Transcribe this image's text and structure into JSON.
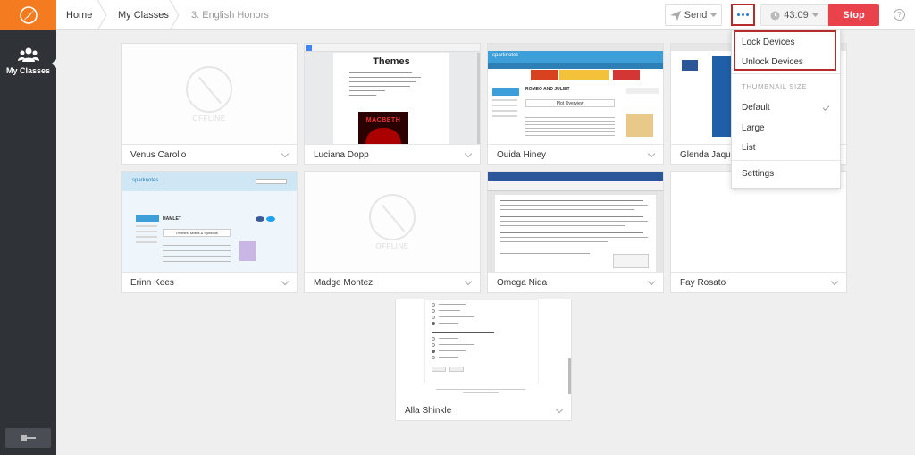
{
  "sidebar": {
    "nav_label": "My Classes"
  },
  "breadcrumb": {
    "items": [
      "Home",
      "My Classes",
      "3. English Honors"
    ]
  },
  "toolbar": {
    "send_label": "Send",
    "timer": "43:09",
    "stop_label": "Stop",
    "help": "?"
  },
  "menu": {
    "lock": "Lock Devices",
    "unlock": "Unlock Devices",
    "thumb_header": "THUMBNAIL SIZE",
    "sizes": [
      "Default",
      "Large",
      "List"
    ],
    "selected": "Default",
    "settings": "Settings"
  },
  "offline_text": "OFFLINE",
  "students": [
    {
      "name": "Venus Carollo",
      "status": "offline"
    },
    {
      "name": "Luciana Dopp",
      "status": "doc"
    },
    {
      "name": "Ouida Hiney",
      "status": "sparknotes"
    },
    {
      "name": "Glenda Jaqu",
      "status": "blue"
    },
    {
      "name": "Erinn Kees",
      "status": "sparknotes2"
    },
    {
      "name": "Madge Montez",
      "status": "offline"
    },
    {
      "name": "Omega Nida",
      "status": "word"
    },
    {
      "name": "Fay Rosato",
      "status": "blank"
    },
    {
      "name": "Alla Shinkle",
      "status": "quiz"
    }
  ],
  "thumbs": {
    "doc_title": "Themes",
    "doc_image_text": "MACBETH",
    "spark_brand": "sparknotes",
    "spark_heading": "ROMEO AND JULIET",
    "spark_sub": "Plot Overview",
    "spark2_heading": "HAMLET",
    "spark2_sub": "Themes, Motifs & Symbols"
  },
  "colors": {
    "accent": "#f47b20",
    "stop": "#e9424a",
    "highlight": "#b42c2c",
    "link": "#2a7bd6"
  }
}
